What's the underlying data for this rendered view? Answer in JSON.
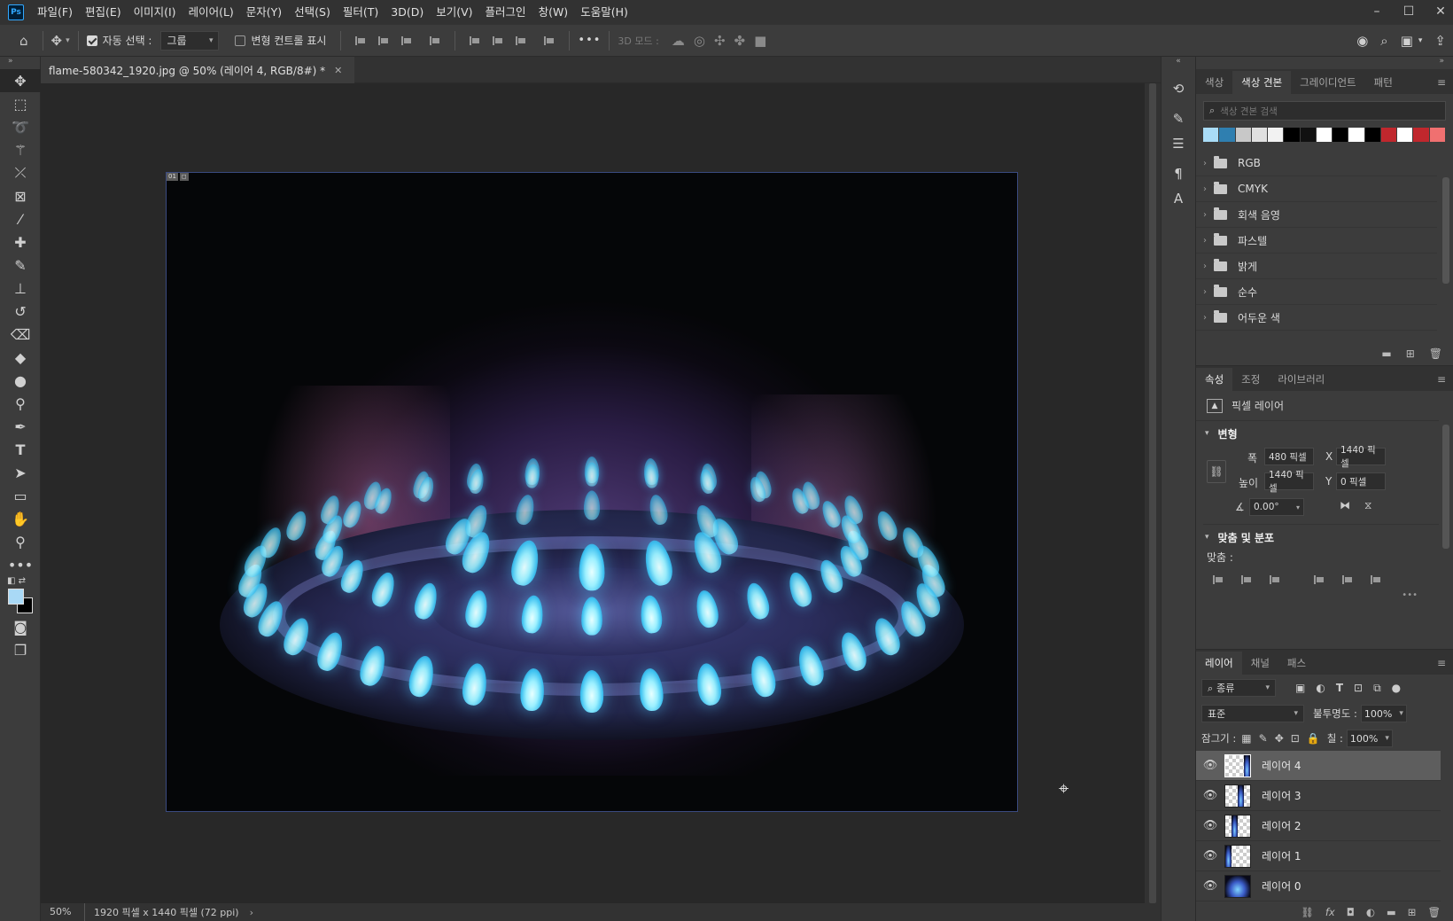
{
  "app": {
    "logo": "Ps",
    "menu": [
      "파일(F)",
      "편집(E)",
      "이미지(I)",
      "레이어(L)",
      "문자(Y)",
      "선택(S)",
      "필터(T)",
      "3D(D)",
      "보기(V)",
      "플러그인",
      "창(W)",
      "도움말(H)"
    ]
  },
  "options": {
    "auto_select_label": "자동 선택 :",
    "auto_select_value": "그룹",
    "transform_controls_label": "변형 컨트롤 표시",
    "more": "•••",
    "mode_3d_label": "3D 모드 :"
  },
  "document": {
    "tab_title": "flame-580342_1920.jpg @ 50% (레이어 4, RGB/8#) *",
    "badges": [
      "01",
      "◻"
    ]
  },
  "status": {
    "zoom": "50%",
    "doc_info": "1920 픽셀 x 1440 픽셀 (72 ppi)"
  },
  "swatches_panel": {
    "tabs": [
      "색상",
      "색상 견본",
      "그레이디언트",
      "패턴"
    ],
    "search_placeholder": "색상 견본 검색",
    "colors": [
      "#a9dcf7",
      "#2f7fb0",
      "#c8c8c8",
      "#e0e0e0",
      "#f2f2f2",
      "#000000",
      "#111111",
      "#ffffff",
      "#000000",
      "#ffffff",
      "#000000",
      "#c0272d",
      "#ffffff",
      "#c0272d",
      "#f07070"
    ],
    "groups": [
      "RGB",
      "CMYK",
      "회색 음영",
      "파스텔",
      "밝게",
      "순수",
      "어두운 색"
    ]
  },
  "properties_panel": {
    "tabs": [
      "속성",
      "조정",
      "라이브러리"
    ],
    "layer_type": "픽셀 레이어",
    "transform_title": "변형",
    "width_label": "폭",
    "width_value": "480 픽셀",
    "x_label": "X",
    "x_value": "1440 픽셀",
    "height_label": "높이",
    "height_value": "1440 픽셀",
    "y_label": "Y",
    "y_value": "0 픽셀",
    "angle_value": "0.00°",
    "align_title": "맞춤 및 분포",
    "align_label": "맞춤 :",
    "more": "•••"
  },
  "layers_panel": {
    "tabs": [
      "레이어",
      "채널",
      "패스"
    ],
    "filter_kind": "종류",
    "blend_mode": "표준",
    "opacity_label": "불투명도 :",
    "opacity_value": "100%",
    "lock_label": "잠그기 :",
    "fill_label": "칠 :",
    "fill_value": "100%",
    "layers": [
      {
        "name": "레이어 4",
        "selected": true
      },
      {
        "name": "레이어 3",
        "selected": false
      },
      {
        "name": "레이어 2",
        "selected": false
      },
      {
        "name": "레이어 1",
        "selected": false
      },
      {
        "name": "레이어 0",
        "selected": false
      }
    ]
  }
}
